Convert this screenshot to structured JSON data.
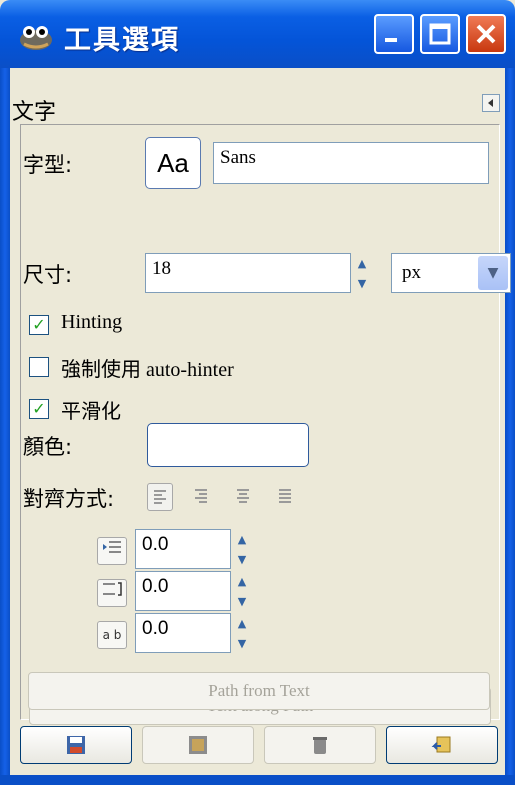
{
  "window": {
    "title": "工具選項"
  },
  "dock": {
    "title": "文字"
  },
  "font": {
    "label": "字型:",
    "preview": "Aa",
    "value": "Sans"
  },
  "size": {
    "label": "尺寸:",
    "value": "18",
    "unit": "px"
  },
  "hinting": {
    "label": "Hinting",
    "checked": true
  },
  "autohinter": {
    "label": "強制使用 auto-hinter",
    "checked": false
  },
  "antialias": {
    "label": "平滑化",
    "checked": true
  },
  "color": {
    "label": "顏色:",
    "value": "#ffffff"
  },
  "justify": {
    "label": "對齊方式:"
  },
  "indent": {
    "value": "0.0"
  },
  "line_spacing": {
    "value": "0.0"
  },
  "letter_spacing": {
    "value": "0.0",
    "icon_text": "a b"
  },
  "buttons": {
    "text_along_path": "Text along Path",
    "path_from_text": "Path from Text"
  },
  "colors": {
    "titlebar": "#0454d8",
    "background": "#ece9d8",
    "close": "#c8380f"
  }
}
